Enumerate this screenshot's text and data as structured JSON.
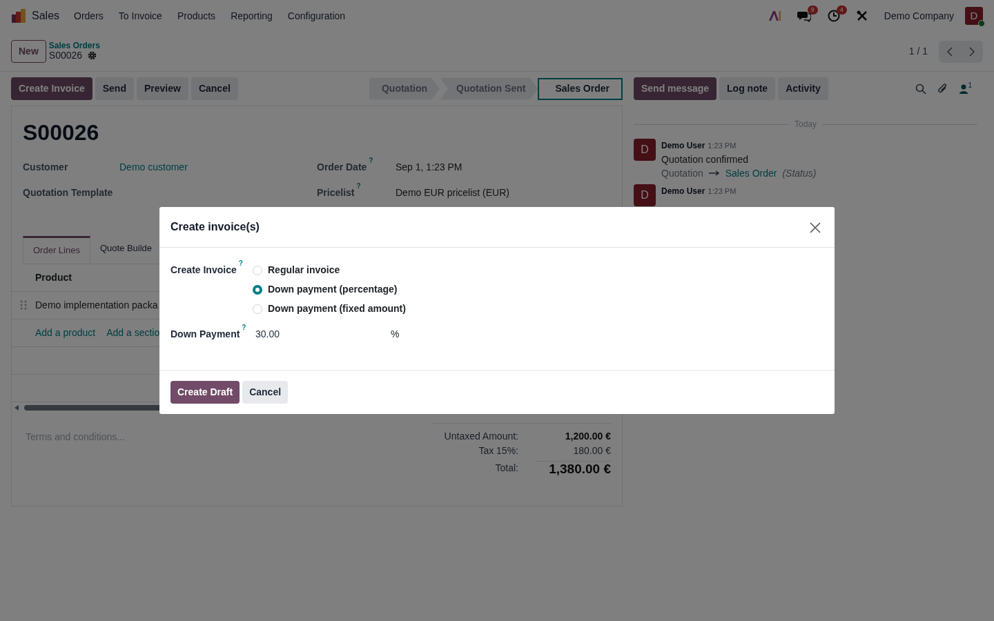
{
  "navbar": {
    "app": "Sales",
    "menus": [
      "Orders",
      "To Invoice",
      "Products",
      "Reporting",
      "Configuration"
    ],
    "chat_count": "9",
    "activity_count": "4",
    "company": "Demo Company",
    "avatar": "D"
  },
  "control_panel": {
    "new_button": "New",
    "breadcrumb": "Sales Orders",
    "record": "S00026",
    "pager": "1 / 1"
  },
  "actions": [
    {
      "label": "Create Invoice",
      "kind": "primary"
    },
    {
      "label": "Send",
      "kind": "secondary"
    },
    {
      "label": "Preview",
      "kind": "secondary"
    },
    {
      "label": "Cancel",
      "kind": "secondary"
    }
  ],
  "statusbar": [
    {
      "label": "Quotation",
      "selected": false
    },
    {
      "label": "Quotation Sent",
      "selected": false
    },
    {
      "label": "Sales Order",
      "selected": true
    }
  ],
  "form": {
    "title": "S00026",
    "fields_left": [
      {
        "label": "Customer",
        "value": "Demo customer",
        "link": true
      },
      {
        "label": "Quotation Template"
      }
    ],
    "fields_right": [
      {
        "label": "Order Date",
        "help": "?",
        "value": "Sep 1, 1:23 PM"
      },
      {
        "label": "Pricelist",
        "help": "?",
        "value": "Demo EUR pricelist (EUR)"
      }
    ],
    "tabs": [
      {
        "label": "Order Lines",
        "selected": true
      },
      {
        "label": "Quote Builde",
        "selected": false
      }
    ],
    "table_header": "Product",
    "rows": [
      "Demo implementation packa"
    ],
    "add_links": [
      "Add a product",
      "Add a sectio"
    ],
    "terms_placeholder": "Terms and conditions...",
    "totals": [
      {
        "label": "Untaxed Amount:",
        "value": "1,200.00 €",
        "kind": "subtotal"
      },
      {
        "label": "Tax 15%:",
        "value": "180.00 €",
        "kind": "tax"
      },
      {
        "label": "Total:",
        "value": "1,380.00 €",
        "kind": "total"
      }
    ]
  },
  "chatter": {
    "buttons": [
      {
        "label": "Send message",
        "kind": "primary"
      },
      {
        "label": "Log note",
        "kind": "secondary"
      },
      {
        "label": "Activity",
        "kind": "secondary"
      }
    ],
    "follower_count": "1",
    "date_separator": "Today",
    "messages": [
      {
        "author": "Demo User",
        "time": "1:23 PM",
        "avatar": "D",
        "body": "Quotation confirmed",
        "change": {
          "old": "Quotation",
          "new": "Sales Order",
          "field": "(Status)"
        }
      },
      {
        "author": "Demo User",
        "time": "1:23 PM",
        "avatar": "D"
      }
    ]
  },
  "dialog": {
    "title": "Create invoice(s)",
    "method_label": "Create Invoice",
    "method_help": "?",
    "options": [
      {
        "label": "Regular invoice",
        "selected": false
      },
      {
        "label": "Down payment (percentage)",
        "selected": true
      },
      {
        "label": "Down payment (fixed amount)",
        "selected": false
      }
    ],
    "amount_label": "Down Payment",
    "amount_help": "?",
    "amount": "30.00",
    "unit": "%",
    "buttons": [
      {
        "label": "Create Draft",
        "kind": "primary"
      },
      {
        "label": "Cancel",
        "kind": "secondary"
      }
    ]
  }
}
